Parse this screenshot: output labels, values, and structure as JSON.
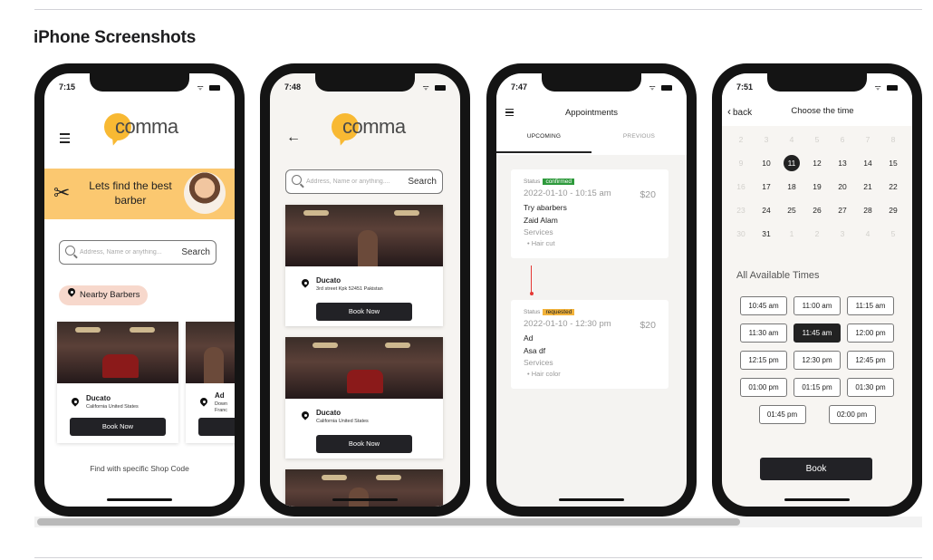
{
  "section": {
    "title": "iPhone Screenshots"
  },
  "phones": [
    {
      "time": "7:15",
      "logo": "comma",
      "banner": "Lets find the best barber",
      "search": {
        "placeholder": "Address, Name or anything...",
        "button": "Search"
      },
      "nearby": "Nearby Barbers",
      "cards": [
        {
          "name": "Ducato",
          "address": "California United States",
          "book": "Book Now"
        },
        {
          "name": "Ad",
          "address": "Down",
          "address2": "Franc",
          "book": ""
        }
      ],
      "footer": "Find with specific Shop Code"
    },
    {
      "time": "7:48",
      "logo": "comma",
      "search": {
        "placeholder": "Address, Name or anything....",
        "button": "Search"
      },
      "cards": [
        {
          "name": "Ducato",
          "address": "3rd street Kpk 52451 Pakistan",
          "book": "Book Now"
        },
        {
          "name": "Ducato",
          "address": "California United States",
          "book": "Book Now"
        }
      ]
    },
    {
      "time": "7:47",
      "title": "Appointments",
      "tabs": [
        "UPCOMING",
        "PREVIOUS"
      ],
      "appointments": [
        {
          "status_label": "Status",
          "status": "confirmed",
          "datetime": "2022-01-10 - 10:15 am",
          "price": "$20",
          "shop": "Try abarbers",
          "barber": "Zaid Alam",
          "services_label": "Services",
          "service": "Hair cut"
        },
        {
          "status_label": "Status",
          "status": "requested",
          "datetime": "2022-01-10 - 12:30 pm",
          "price": "$20",
          "shop": "Ad",
          "barber": "Asa df",
          "services_label": "Services",
          "service": "Hair color"
        }
      ]
    },
    {
      "time": "7:51",
      "back": "back",
      "title": "Choose the time",
      "calendar": {
        "rows": [
          [
            "2",
            "3",
            "4",
            "5",
            "6",
            "7",
            "8"
          ],
          [
            "9",
            "10",
            "11",
            "12",
            "13",
            "14",
            "15"
          ],
          [
            "16",
            "17",
            "18",
            "19",
            "20",
            "21",
            "22"
          ],
          [
            "23",
            "24",
            "25",
            "26",
            "27",
            "28",
            "29"
          ],
          [
            "30",
            "31",
            "1",
            "2",
            "3",
            "4",
            "5"
          ]
        ],
        "selected": "11"
      },
      "available_label": "All Available Times",
      "times": [
        [
          "10:45 am",
          "11:00 am",
          "11:15 am"
        ],
        [
          "11:30 am",
          "11:45 am",
          "12:00 pm"
        ],
        [
          "12:15 pm",
          "12:30 pm",
          "12:45 pm"
        ],
        [
          "01:00 pm",
          "01:15 pm",
          "01:30 pm"
        ],
        [
          "01:45 pm",
          "02:00 pm"
        ]
      ],
      "selected_time": "11:45 am",
      "book": "Book"
    }
  ]
}
